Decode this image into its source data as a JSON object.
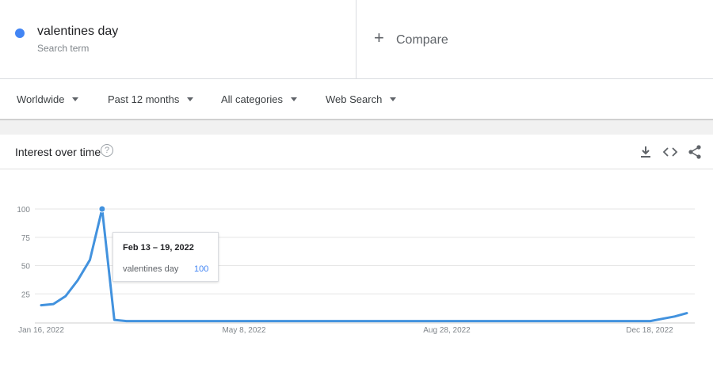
{
  "search_term": {
    "name": "valentines day",
    "type": "Search term",
    "color": "#4285f4"
  },
  "compare": {
    "icon": "plus-icon",
    "label": "Compare"
  },
  "filters": [
    {
      "label": "Worldwide"
    },
    {
      "label": "Past 12 months"
    },
    {
      "label": "All categories"
    },
    {
      "label": "Web Search"
    }
  ],
  "card": {
    "title": "Interest over time",
    "help_icon": "?",
    "actions": [
      "download-icon",
      "embed-icon",
      "share-icon"
    ]
  },
  "tooltip": {
    "date": "Feb 13 – 19, 2022",
    "series": "valentines day",
    "value": "100"
  },
  "chart_data": {
    "type": "line",
    "y_ticks": [
      25,
      50,
      75,
      100
    ],
    "ylim": [
      0,
      100
    ],
    "x_tick_labels": [
      "Jan 16, 2022",
      "May 8, 2022",
      "Aug 28, 2022",
      "Dec 18, 2022"
    ],
    "grid": true,
    "line_color": "#4292de",
    "series": [
      {
        "name": "valentines day",
        "values": [
          15,
          16,
          23,
          37,
          55,
          100,
          2,
          1,
          1,
          1,
          1,
          1,
          1,
          1,
          1,
          1,
          1,
          1,
          1,
          1,
          1,
          1,
          1,
          1,
          1,
          1,
          1,
          1,
          1,
          1,
          1,
          1,
          1,
          1,
          1,
          1,
          1,
          1,
          1,
          1,
          1,
          1,
          1,
          1,
          1,
          1,
          1,
          1,
          1,
          1,
          1,
          3,
          5,
          8
        ]
      }
    ],
    "highlight_index": 5
  }
}
